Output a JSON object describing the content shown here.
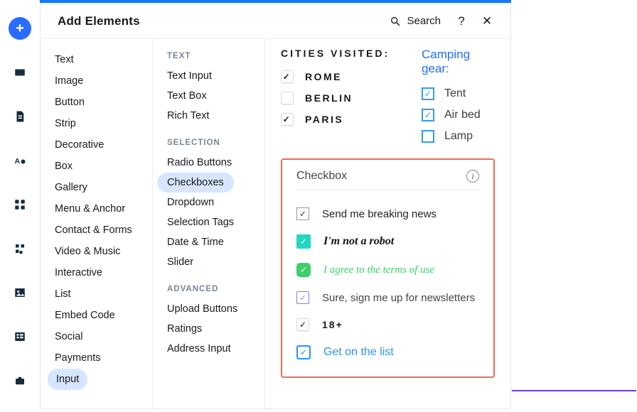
{
  "header": {
    "title": "Add Elements",
    "search": "Search"
  },
  "rail": [
    "plus",
    "panels",
    "page",
    "text-drop",
    "apps",
    "plugins",
    "image",
    "table",
    "store"
  ],
  "categories": [
    "Text",
    "Image",
    "Button",
    "Strip",
    "Decorative",
    "Box",
    "Gallery",
    "Menu & Anchor",
    "Contact & Forms",
    "Video & Music",
    "Interactive",
    "List",
    "Embed Code",
    "Social",
    "Payments",
    "Input"
  ],
  "categories_active": "Input",
  "subgroups": {
    "text": {
      "title": "TEXT",
      "items": [
        "Text Input",
        "Text Box",
        "Rich Text"
      ]
    },
    "selection": {
      "title": "SELECTION",
      "items": [
        "Radio Buttons",
        "Checkboxes",
        "Dropdown",
        "Selection Tags",
        "Date & Time",
        "Slider"
      ],
      "active": "Checkboxes"
    },
    "advanced": {
      "title": "ADVANCED",
      "items": [
        "Upload Buttons",
        "Ratings",
        "Address Input"
      ]
    }
  },
  "preview": {
    "cities": {
      "title": "CITIES VISITED:",
      "items": [
        {
          "label": "ROME",
          "checked": true
        },
        {
          "label": "BERLIN",
          "checked": false
        },
        {
          "label": "PARIS",
          "checked": true
        }
      ]
    },
    "camping": {
      "title": "Camping gear:",
      "items": [
        {
          "label": "Tent",
          "checked": true
        },
        {
          "label": "Air bed",
          "checked": true
        },
        {
          "label": "Lamp",
          "checked": false
        }
      ]
    },
    "highlight": {
      "title": "Checkbox",
      "rows": [
        {
          "label": "Send me breaking news"
        },
        {
          "label": "I'm not a robot"
        },
        {
          "label": "I agree to the terms of use"
        },
        {
          "label": "Sure, sign me up for newsletters"
        },
        {
          "label": "18+"
        },
        {
          "label": "Get on the list"
        }
      ]
    }
  }
}
